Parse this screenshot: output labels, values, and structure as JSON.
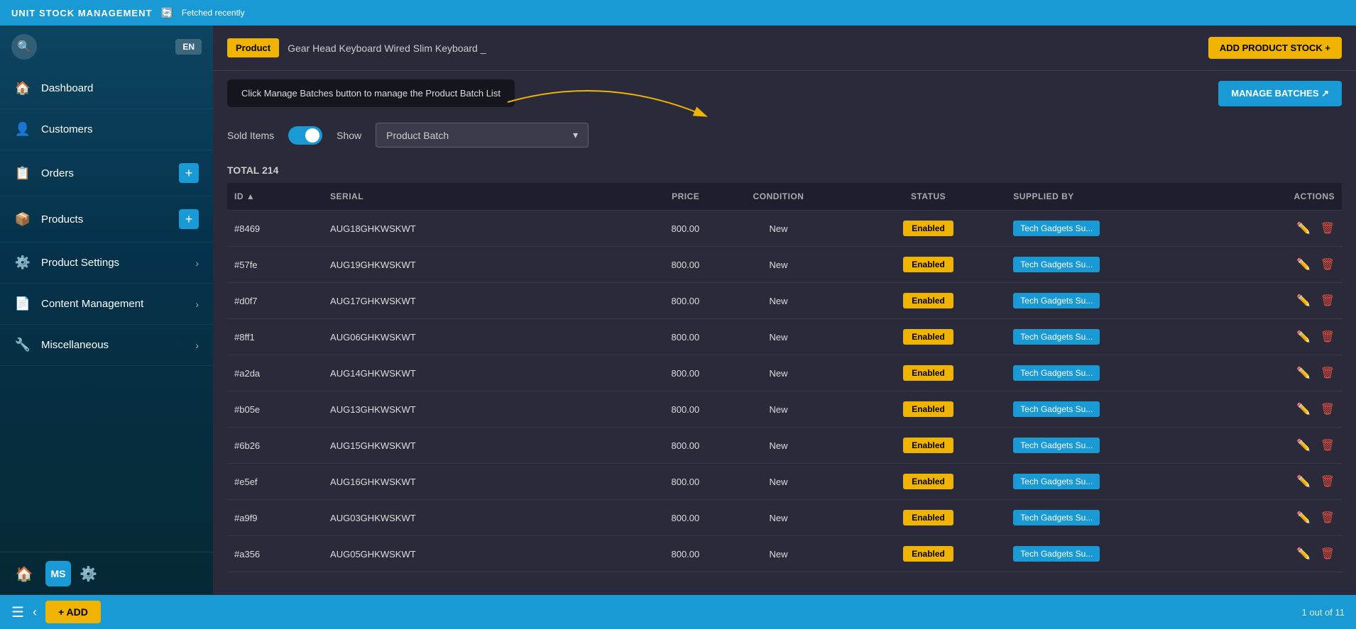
{
  "topBar": {
    "title": "UNIT STOCK MANAGEMENT",
    "fetchStatus": "Fetched recently"
  },
  "lang": "EN",
  "sidebar": {
    "items": [
      {
        "id": "dashboard",
        "icon": "🏠",
        "label": "Dashboard",
        "hasAdd": false,
        "hasChevron": false
      },
      {
        "id": "customers",
        "icon": "👤",
        "label": "Customers",
        "hasAdd": false,
        "hasChevron": false
      },
      {
        "id": "orders",
        "icon": "📋",
        "label": "Orders",
        "hasAdd": true,
        "hasChevron": false
      },
      {
        "id": "products",
        "icon": "📦",
        "label": "Products",
        "hasAdd": true,
        "hasChevron": false
      },
      {
        "id": "product-settings",
        "icon": "⚙️",
        "label": "Product Settings",
        "hasAdd": false,
        "hasChevron": true
      },
      {
        "id": "content-management",
        "icon": "📄",
        "label": "Content Management",
        "hasAdd": false,
        "hasChevron": true
      },
      {
        "id": "miscellaneous",
        "icon": "🔧",
        "label": "Miscellaneous",
        "hasAdd": false,
        "hasChevron": true
      }
    ]
  },
  "header": {
    "productLabel": "Product",
    "productName": "Gear Head Keyboard Wired Slim Keyboard _",
    "addStockBtn": "ADD PRODUCT STOCK +"
  },
  "tooltip": {
    "text": "Click Manage Batches button to manage the Product Batch List",
    "manageBatchesBtn": "MANAGE BATCHES ↗"
  },
  "controls": {
    "soldItemsLabel": "Sold Items",
    "showLabel": "Show",
    "batchDropdownPlaceholder": "Product Batch",
    "toggleOn": true
  },
  "table": {
    "totalLabel": "TOTAL 214",
    "columns": [
      "ID",
      "SERIAL",
      "PRICE",
      "CONDITION",
      "STATUS",
      "SUPPLIED BY",
      "ACTIONS"
    ],
    "rows": [
      {
        "id": "#8469",
        "serial": "AUG18GHKWSKWT",
        "price": "800.00",
        "condition": "New",
        "status": "Enabled",
        "supplier": "Tech Gadgets Su..."
      },
      {
        "id": "#57fe",
        "serial": "AUG19GHKWSKWT",
        "price": "800.00",
        "condition": "New",
        "status": "Enabled",
        "supplier": "Tech Gadgets Su..."
      },
      {
        "id": "#d0f7",
        "serial": "AUG17GHKWSKWT",
        "price": "800.00",
        "condition": "New",
        "status": "Enabled",
        "supplier": "Tech Gadgets Su..."
      },
      {
        "id": "#8ff1",
        "serial": "AUG06GHKWSKWT",
        "price": "800.00",
        "condition": "New",
        "status": "Enabled",
        "supplier": "Tech Gadgets Su..."
      },
      {
        "id": "#a2da",
        "serial": "AUG14GHKWSKWT",
        "price": "800.00",
        "condition": "New",
        "status": "Enabled",
        "supplier": "Tech Gadgets Su..."
      },
      {
        "id": "#b05e",
        "serial": "AUG13GHKWSKWT",
        "price": "800.00",
        "condition": "New",
        "status": "Enabled",
        "supplier": "Tech Gadgets Su..."
      },
      {
        "id": "#6b26",
        "serial": "AUG15GHKWSKWT",
        "price": "800.00",
        "condition": "New",
        "status": "Enabled",
        "supplier": "Tech Gadgets Su..."
      },
      {
        "id": "#e5ef",
        "serial": "AUG16GHKWSKWT",
        "price": "800.00",
        "condition": "New",
        "status": "Enabled",
        "supplier": "Tech Gadgets Su..."
      },
      {
        "id": "#a9f9",
        "serial": "AUG03GHKWSKWT",
        "price": "800.00",
        "condition": "New",
        "status": "Enabled",
        "supplier": "Tech Gadgets Su..."
      },
      {
        "id": "#a356",
        "serial": "AUG05GHKWSKWT",
        "price": "800.00",
        "condition": "New",
        "status": "Enabled",
        "supplier": "Tech Gadgets Su..."
      }
    ]
  },
  "bottomBar": {
    "addBtn": "+ ADD",
    "pagination": "1  out of 11"
  },
  "colors": {
    "accent": "#1a9ad4",
    "yellow": "#f0b300",
    "danger": "#e74c3c",
    "statusEnabled": "#f0b300",
    "supplierBadge": "#1a9ad4"
  }
}
